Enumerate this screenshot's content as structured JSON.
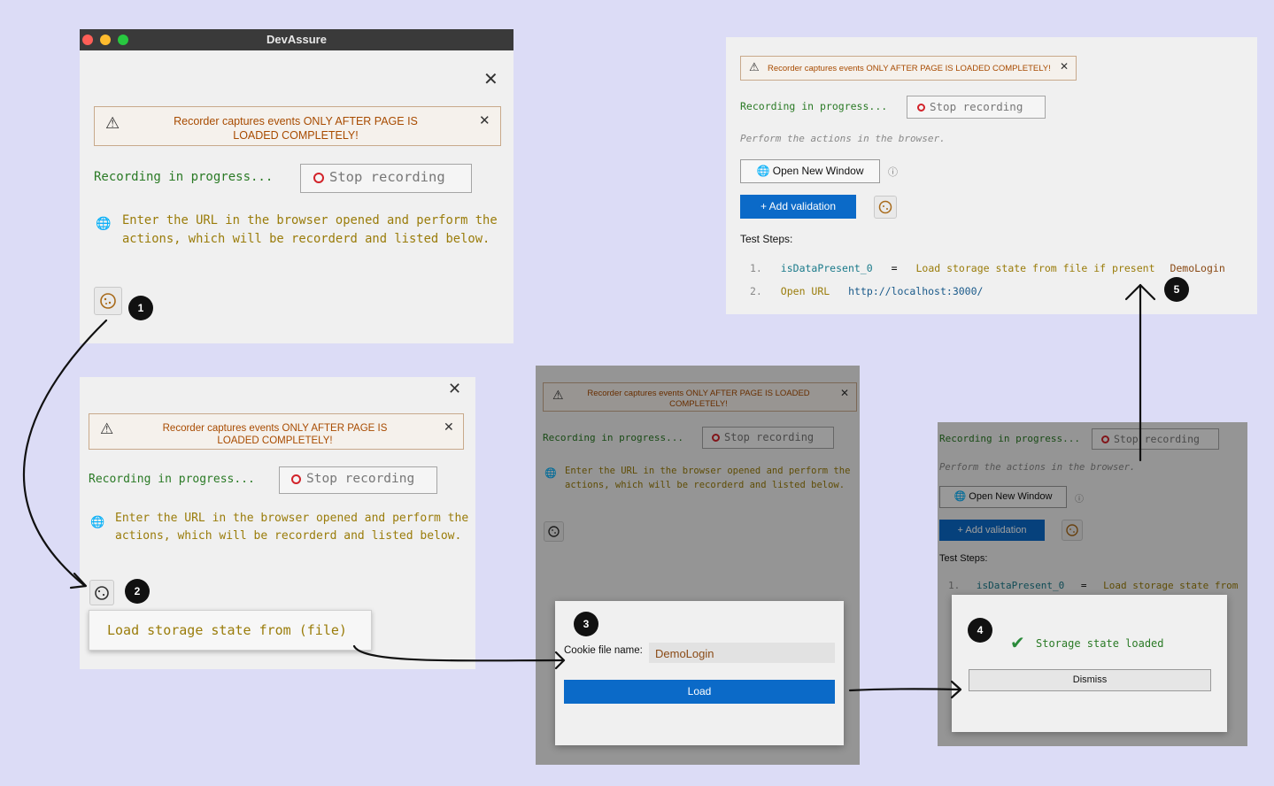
{
  "window": {
    "title": "DevAssure"
  },
  "common": {
    "warning": "Recorder captures events ONLY AFTER PAGE IS LOADED COMPLETELY!",
    "recording": "Recording in progress...",
    "stop": "Stop recording",
    "instructions": "Enter the URL in the browser opened and perform the actions, which will be recorderd and listed below.",
    "perform": "Perform the actions in the browser."
  },
  "steps": {
    "s1": "1",
    "s2": "2",
    "s3": "3",
    "s4": "4",
    "s5": "5"
  },
  "menu": {
    "load_storage": "Load storage state from (file)"
  },
  "dialog_load": {
    "label": "Cookie file name:",
    "value": "DemoLogin",
    "button": "Load"
  },
  "dialog_done": {
    "message": "Storage state loaded",
    "button": "Dismiss"
  },
  "panel_final": {
    "open_window": "Open New Window",
    "add_validation": "Add validation",
    "test_steps_label": "Test Steps:",
    "steps": [
      {
        "num": "1.",
        "var": "isDataPresent_0",
        "eq": "=",
        "action": "Load storage state from file if present",
        "arg": "DemoLogin"
      },
      {
        "num": "2.",
        "action": "Open URL",
        "arg": "http://localhost:3000/"
      }
    ]
  },
  "colors": {
    "background": "#dcdcf6",
    "accent_blue": "#0b6ac8",
    "warning_text": "#a84b00",
    "recording_green": "#2a7a25",
    "record_red": "#d2232a"
  }
}
